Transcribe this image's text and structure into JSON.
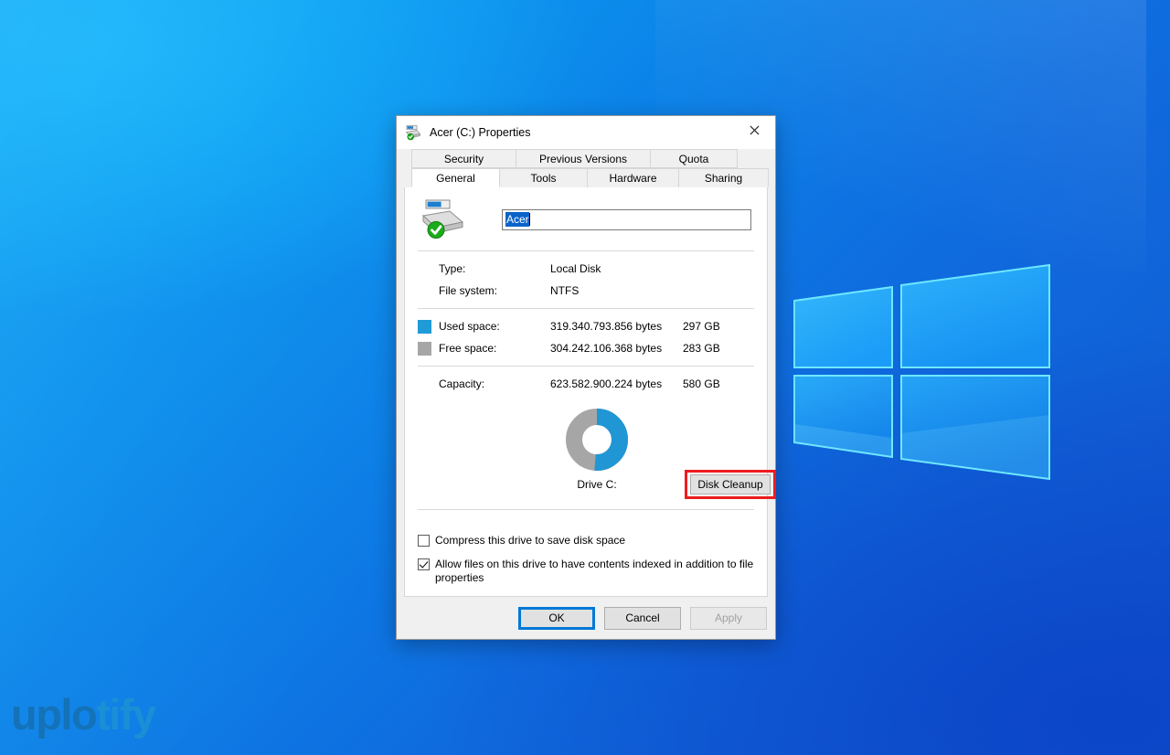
{
  "desktop": {
    "watermark_part_a": "uplo",
    "watermark_part_b": "tify",
    "wallpaper_name": "windows-logo-wallpaper"
  },
  "window": {
    "title": "Acer (C:) Properties",
    "icon": "drive-icon",
    "close_label": "✕"
  },
  "tabs": {
    "row_top": [
      {
        "label": "Security",
        "active": false
      },
      {
        "label": "Previous Versions",
        "active": false
      },
      {
        "label": "Quota",
        "active": false
      }
    ],
    "row_bottom": [
      {
        "label": "General",
        "active": true
      },
      {
        "label": "Tools",
        "active": false
      },
      {
        "label": "Hardware",
        "active": false
      },
      {
        "label": "Sharing",
        "active": false
      }
    ]
  },
  "general": {
    "volume_label_value": "Acer",
    "volume_label_placeholder": "",
    "type_label": "Type:",
    "type_value": "Local Disk",
    "filesystem_label": "File system:",
    "filesystem_value": "NTFS",
    "used_label": "Used space:",
    "used_bytes": "319.340.793.856 bytes",
    "used_gb": "297 GB",
    "used_color": "#1f9bd8",
    "free_label": "Free space:",
    "free_bytes": "304.242.106.368 bytes",
    "free_gb": "283 GB",
    "free_color": "#a6a6a6",
    "capacity_label": "Capacity:",
    "capacity_bytes": "623.582.900.224 bytes",
    "capacity_gb": "580 GB",
    "drive_caption": "Drive C:",
    "disk_cleanup_label": "Disk Cleanup",
    "highlight_color": "#ee1c1c",
    "compress_label": "Compress this drive to save disk space",
    "compress_checked": false,
    "index_label": "Allow files on this drive to have contents indexed in addition to file properties",
    "index_checked": true
  },
  "chart_data": {
    "type": "pie",
    "title": "Drive C:",
    "labels": [
      "Used space",
      "Free space"
    ],
    "values": [
      319340793856,
      304242106368
    ],
    "display_values": [
      "297 GB",
      "283 GB"
    ],
    "percentages": [
      51.2,
      48.8
    ],
    "colors": [
      "#1f9bd8",
      "#a6a6a6"
    ],
    "donut": true,
    "legend": "left-list"
  },
  "footer": {
    "ok_label": "OK",
    "cancel_label": "Cancel",
    "apply_label": "Apply",
    "apply_disabled": true,
    "ok_focused": true
  }
}
